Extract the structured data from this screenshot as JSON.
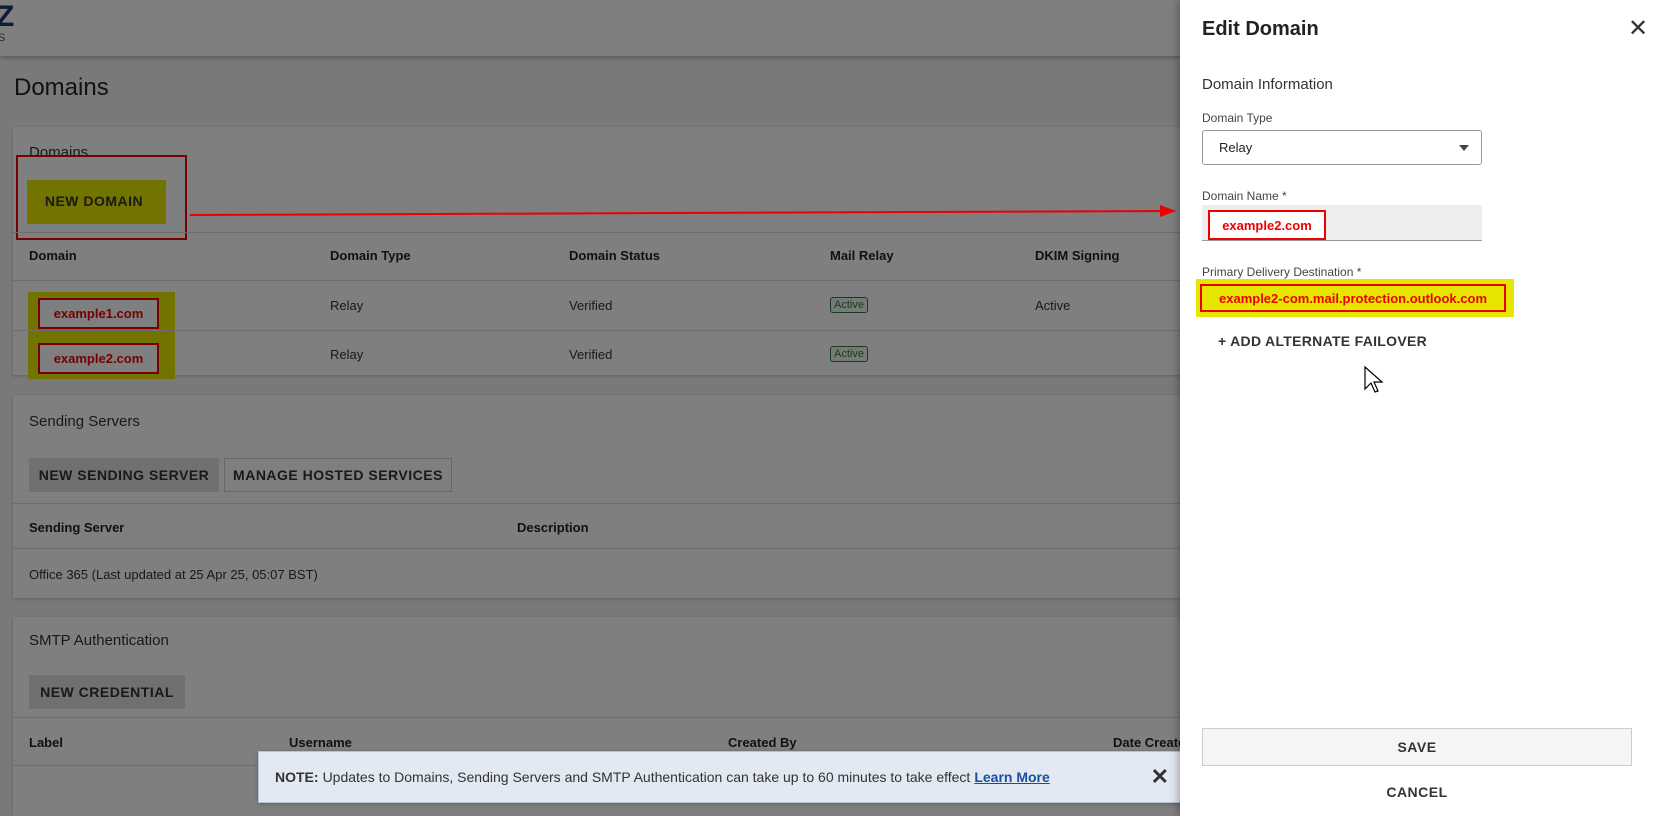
{
  "logo": {
    "mark": "Z",
    "sub": "S"
  },
  "page": {
    "title": "Domains"
  },
  "domains_card": {
    "title": "Domains",
    "new_button": "NEW DOMAIN",
    "columns": [
      "Domain",
      "Domain Type",
      "Domain Status",
      "Mail Relay",
      "DKIM Signing"
    ],
    "rows": [
      {
        "domain": "example1.com",
        "type": "Relay",
        "status": "Verified",
        "mail_relay": "Active",
        "dkim": "Active"
      },
      {
        "domain": "example2.com",
        "type": "Relay",
        "status": "Verified",
        "mail_relay": "Active",
        "dkim": ""
      }
    ]
  },
  "sending_card": {
    "title": "Sending Servers",
    "new_button": "NEW SENDING SERVER",
    "manage_button": "MANAGE HOSTED SERVICES",
    "columns": [
      "Sending Server",
      "Description"
    ],
    "rows": [
      {
        "server": "Office 365 (Last updated at 25 Apr 25, 05:07 BST)"
      }
    ]
  },
  "smtp_card": {
    "title": "SMTP Authentication",
    "new_button": "NEW CREDENTIAL",
    "columns": [
      "Label",
      "Username",
      "Created By",
      "Date Create"
    ]
  },
  "note": {
    "prefix": "NOTE:",
    "text": "Updates to Domains, Sending Servers and SMTP Authentication can take up to 60 minutes to take effect",
    "link": "Learn More",
    "close": "✕"
  },
  "drawer": {
    "title": "Edit Domain",
    "close": "✕",
    "section": "Domain Information",
    "domain_type_label": "Domain Type",
    "domain_type_value": "Relay",
    "domain_name_label": "Domain Name *",
    "domain_name_value": "example2.com",
    "primary_label": "Primary Delivery Destination *",
    "primary_value": "example2-com.mail.protection.outlook.com",
    "add_failover": "+ ADD ALTERNATE FAILOVER",
    "save": "SAVE",
    "cancel": "CANCEL"
  },
  "colors": {
    "annotation_red": "#e00000",
    "highlight_yellow": "#e6e600",
    "overlay": "rgba(0,0,0,0.5)"
  }
}
